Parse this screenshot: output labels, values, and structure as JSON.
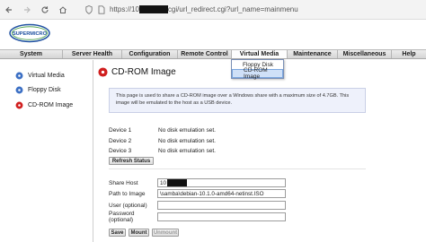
{
  "browser": {
    "url_prefix": "https://10",
    "url_suffix": "cgi/url_redirect.cgi?url_name=mainmenu"
  },
  "logo": {
    "text": "SUPERMICRO"
  },
  "menu": {
    "items": [
      {
        "label": "System"
      },
      {
        "label": "Server Health"
      },
      {
        "label": "Configuration"
      },
      {
        "label": "Remote Control"
      },
      {
        "label": "Virtual Media"
      },
      {
        "label": "Maintenance"
      },
      {
        "label": "Miscellaneous"
      },
      {
        "label": "Help"
      }
    ]
  },
  "dropdown": {
    "items": [
      {
        "label": "Floppy Disk"
      },
      {
        "label": "CD-ROM Image"
      }
    ]
  },
  "sidebar": {
    "items": [
      {
        "label": "Virtual Media"
      },
      {
        "label": "Floppy Disk"
      },
      {
        "label": "CD-ROM Image"
      }
    ]
  },
  "main": {
    "title": "CD-ROM Image",
    "info": "This page is used to share a CD-ROM image over a Windows share with a maximum size of 4.7GB. This image will be emulated to the host as a USB device.",
    "devices": [
      {
        "label": "Device 1",
        "status": "No disk emulation set."
      },
      {
        "label": "Device 2",
        "status": "No disk emulation set."
      },
      {
        "label": "Device 3",
        "status": "No disk emulation set."
      }
    ],
    "refresh_label": "Refresh Status",
    "form": {
      "share_host_label": "Share Host",
      "share_host_value": "10",
      "path_label": "Path to Image",
      "path_value": "\\samba\\debian-10.1.0-amd64-netinst.ISO",
      "user_label": "User (optional)",
      "user_value": "",
      "password_label": "Password (optional)",
      "password_value": ""
    },
    "buttons": {
      "save": "Save",
      "mount": "Mount",
      "unmount": "Unmount"
    }
  },
  "colors": {
    "menu_gradient_top": "#ececec",
    "dropdown_highlight": "#cfe0f7",
    "info_bg": "#eef1fb",
    "icon_red": "#d01f1f",
    "icon_blue": "#3b6fc4"
  }
}
